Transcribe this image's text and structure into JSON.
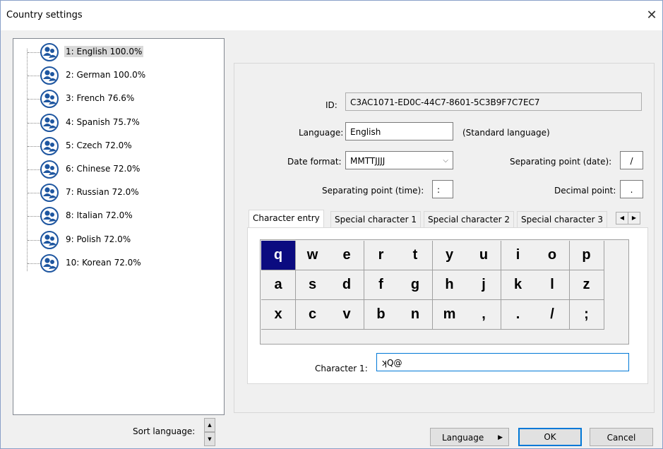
{
  "window": {
    "title": "Country settings",
    "close_icon": "close-icon"
  },
  "tree": {
    "items": [
      {
        "label": "1: English   100.0%",
        "selected": true
      },
      {
        "label": "2: German   100.0%"
      },
      {
        "label": "3: French  76.6%"
      },
      {
        "label": "4: Spanish  75.7%"
      },
      {
        "label": "5: Czech  72.0%"
      },
      {
        "label": "6: Chinese  72.0%"
      },
      {
        "label": "7: Russian  72.0%"
      },
      {
        "label": "8: Italian  72.0%"
      },
      {
        "label": "9: Polish  72.0%"
      },
      {
        "label": "10: Korean  72.0%"
      }
    ]
  },
  "sort": {
    "label": "Sort language:"
  },
  "form": {
    "id_label": "ID:",
    "id_value": "C3AC1071-ED0C-44C7-8601-5C3B9F7C7EC7",
    "language_label": "Language:",
    "language_value": "English",
    "language_note": "(Standard language)",
    "date_format_label": "Date format:",
    "date_format_value": "MMTTJJJJ",
    "sep_date_label": "Separating point (date):",
    "sep_date_value": "/",
    "sep_time_label": "Separating point (time):",
    "sep_time_value": ":",
    "decimal_label": "Decimal point:",
    "decimal_value": "."
  },
  "tabs": [
    "Character entry",
    "Special character 1",
    "Special character 2",
    "Special character 3"
  ],
  "keyboard": {
    "rows": [
      [
        "q",
        "w",
        "e",
        "r",
        "t",
        "y",
        "u",
        "i",
        "o",
        "p"
      ],
      [
        "a",
        "s",
        "d",
        "f",
        "g",
        "h",
        "j",
        "k",
        "l",
        "z"
      ],
      [
        "x",
        "c",
        "v",
        "b",
        "n",
        "m",
        ",",
        ".",
        "/",
        ";"
      ]
    ],
    "selected": "q"
  },
  "character": {
    "label": "Character 1:",
    "value": "ʞQ@"
  },
  "buttons": {
    "language": "Language",
    "ok": "OK",
    "cancel": "Cancel"
  },
  "colors": {
    "selected_key": "#0b0b80",
    "globe": "#1e56a0",
    "default_button_border": "#0078d7"
  }
}
